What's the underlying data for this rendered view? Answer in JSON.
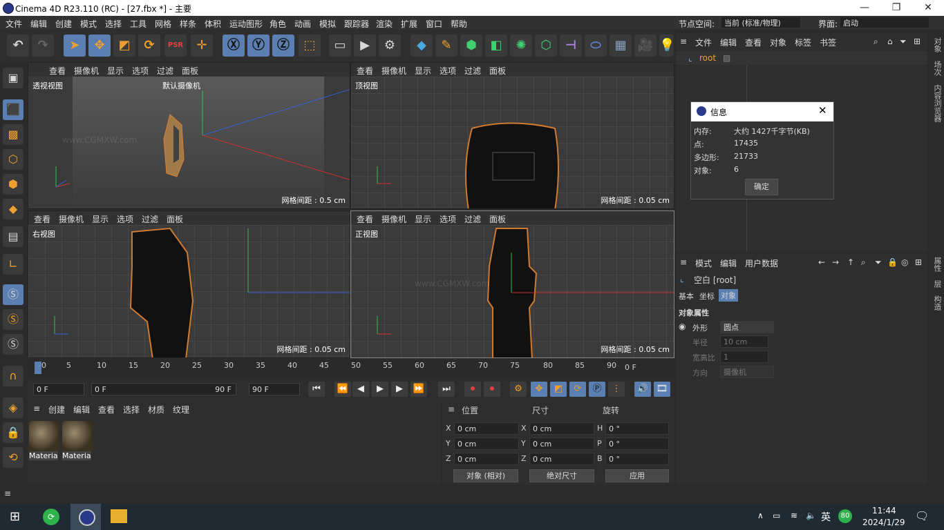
{
  "title": "Cinema 4D R23.110 (RC) - [27.fbx *] - 主要",
  "menus": [
    "文件",
    "编辑",
    "创建",
    "模式",
    "选择",
    "工具",
    "网格",
    "样条",
    "体积",
    "运动图形",
    "角色",
    "动画",
    "模拟",
    "跟踪器",
    "渲染",
    "扩展",
    "窗口",
    "帮助"
  ],
  "node_space": {
    "label": "节点空间:",
    "value": "当前 (标准/物理)"
  },
  "interface": {
    "label": "界面:",
    "value": "启动"
  },
  "toolbar_icons": [
    "undo-icon",
    "redo-icon",
    "select-icon",
    "move-icon",
    "scale-icon",
    "rotate-icon",
    "psr-icon",
    "move-tool-icon",
    "x-axis-icon",
    "y-axis-icon",
    "z-axis-icon",
    "coordinate-icon",
    "render-view-icon",
    "render-icon",
    "render-settings-icon",
    "cube-icon",
    "pen-icon",
    "subdivision-icon",
    "extrude-icon",
    "array-icon",
    "cloner-icon",
    "deformer-icon",
    "field-icon",
    "floor-icon",
    "camera-icon",
    "light-icon"
  ],
  "viewport_menu": [
    "查看",
    "摄像机",
    "显示",
    "选项",
    "过滤",
    "面板"
  ],
  "viewports": {
    "persp": {
      "label": "透视视图",
      "camera": "默认摄像机",
      "grid": "网格间距 : 0.5 cm"
    },
    "top": {
      "label": "顶视图",
      "grid": "网格间距 : 0.05 cm"
    },
    "right": {
      "label": "右视图",
      "grid": "网格间距 : 0.05 cm"
    },
    "front": {
      "label": "正视图",
      "grid": "网格间距 : 0.05 cm"
    }
  },
  "timeline_ticks": [
    "0",
    "5",
    "10",
    "15",
    "20",
    "25",
    "30",
    "35",
    "40",
    "45",
    "50",
    "55",
    "60",
    "65",
    "70",
    "75",
    "80",
    "85",
    "90"
  ],
  "timeline_end": "0 F",
  "play": {
    "start": "0 F",
    "current": "0 F",
    "range_end": "90 F",
    "end": "90 F"
  },
  "material_menu": [
    "创建",
    "编辑",
    "查看",
    "选择",
    "材质",
    "纹理"
  ],
  "materials": [
    "Materia",
    "Materia"
  ],
  "coords": {
    "headers": [
      "位置",
      "尺寸",
      "旋转"
    ],
    "pos": [
      {
        "axis": "X",
        "value": "0 cm"
      },
      {
        "axis": "Y",
        "value": "0 cm"
      },
      {
        "axis": "Z",
        "value": "0 cm"
      }
    ],
    "size": [
      {
        "axis": "X",
        "value": "0 cm"
      },
      {
        "axis": "Y",
        "value": "0 cm"
      },
      {
        "axis": "Z",
        "value": "0 cm"
      }
    ],
    "rot": [
      {
        "axis": "H",
        "value": "0 °"
      },
      {
        "axis": "P",
        "value": "0 °"
      },
      {
        "axis": "B",
        "value": "0 °"
      }
    ],
    "mode": "对象 (相对)",
    "size_mode": "绝对尺寸",
    "apply": "应用"
  },
  "object_manager": {
    "menu": [
      "文件",
      "编辑",
      "查看",
      "对象",
      "标签",
      "书签"
    ],
    "root": "root"
  },
  "attr_manager": {
    "menu": [
      "模式",
      "编辑",
      "用户数据"
    ],
    "object": "空白 [root]",
    "tabs": [
      "基本",
      "坐标",
      "对象"
    ],
    "section": "对象属性",
    "props": [
      {
        "label": "外形",
        "value": "圆点"
      },
      {
        "label": "半径",
        "value": "10 cm"
      },
      {
        "label": "宽高比",
        "value": "1"
      },
      {
        "label": "方向",
        "value": "摄像机"
      }
    ]
  },
  "right_strip": [
    "对象",
    "场次",
    "内容浏览器",
    "属性",
    "层",
    "构造"
  ],
  "dialog": {
    "title": "信息",
    "rows": [
      {
        "label": "内存:",
        "value": "大约 1427千字节(KB)"
      },
      {
        "label": "点:",
        "value": "17435"
      },
      {
        "label": "多边形:",
        "value": "21733"
      },
      {
        "label": "对象:",
        "value": "6"
      }
    ],
    "ok": "确定"
  },
  "watermark": "www.CGMXW.com",
  "taskbar": {
    "time": "11:44",
    "date": "2024/1/29",
    "ime": "英",
    "badge": "80"
  }
}
